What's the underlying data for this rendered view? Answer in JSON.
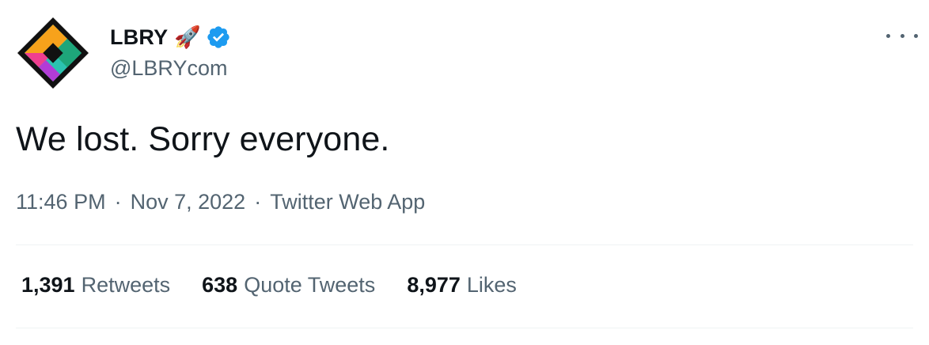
{
  "author": {
    "display_name": "LBRY",
    "emoji": "🚀",
    "handle": "@LBRYcom",
    "verified": true
  },
  "tweet": {
    "text": "We lost. Sorry everyone.",
    "time": "11:46 PM",
    "date": "Nov 7, 2022",
    "source": "Twitter Web App",
    "separator": "·"
  },
  "stats": [
    {
      "count": "1,391",
      "label": "Retweets"
    },
    {
      "count": "638",
      "label": "Quote Tweets"
    },
    {
      "count": "8,977",
      "label": "Likes"
    }
  ],
  "icons": {
    "more": "more-horizontal-icon",
    "verified": "verified-badge-icon",
    "avatar": "lbry-logo"
  },
  "colors": {
    "verified": "#1d9bf0",
    "secondary_text": "#536471",
    "primary_text": "#0f1419"
  }
}
